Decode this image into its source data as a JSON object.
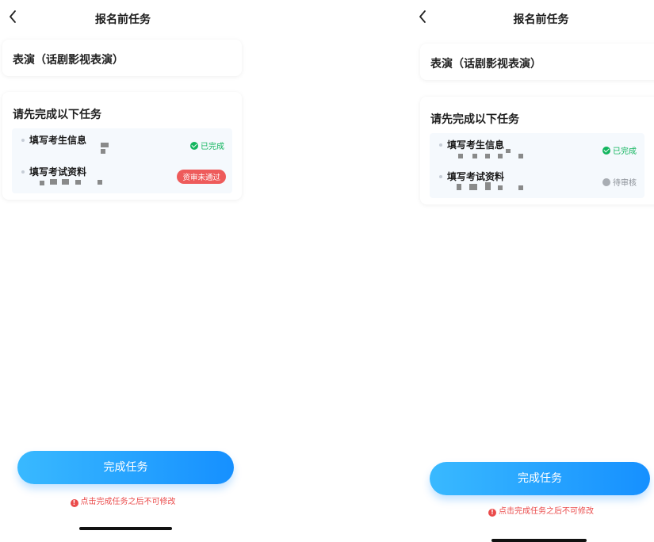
{
  "left": {
    "nav_title": "报名前任务",
    "subject": "表演（话剧影视表演）",
    "tasks_heading": "请先完成以下任务",
    "tasks": [
      {
        "label": "填写考生信息",
        "status": "已完成"
      },
      {
        "label": "填写考试资料",
        "status": "资审未通过"
      }
    ],
    "button": "完成任务",
    "warning": "点击完成任务之后不可修改"
  },
  "right": {
    "nav_title": "报名前任务",
    "subject": "表演（话剧影视表演）",
    "tasks_heading": "请先完成以下任务",
    "tasks": [
      {
        "label": "填写考生信息",
        "status": "已完成"
      },
      {
        "label": "填写考试资料",
        "status": "待审核"
      }
    ],
    "button": "完成任务",
    "warning": "点击完成任务之后不可修改"
  },
  "colors": {
    "primary": "#1690ff",
    "success": "#12b55e",
    "danger": "#ee5b5b",
    "pending": "#a8adb3"
  },
  "icons": [
    "back-arrow-icon",
    "check-circle-icon",
    "pending-dot-icon",
    "warning-icon"
  ]
}
